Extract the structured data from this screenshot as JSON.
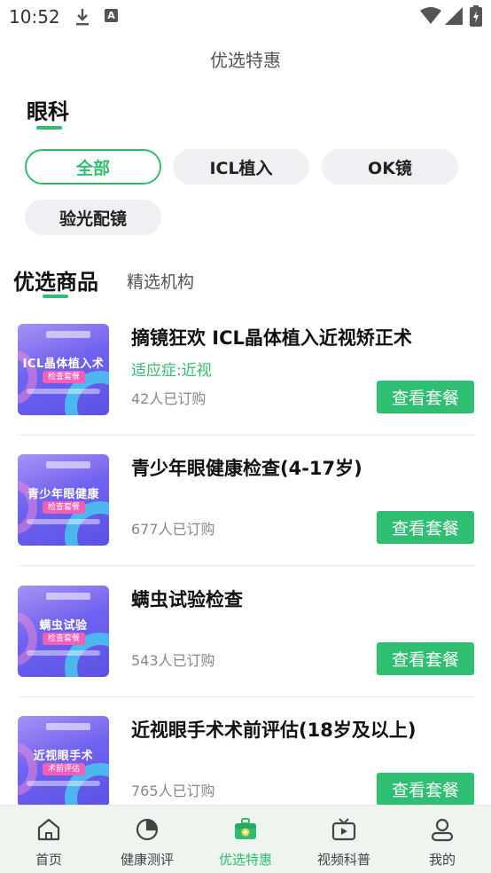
{
  "status_bar": {
    "time": "10:52",
    "a_badge": "A"
  },
  "header": {
    "title": "优选特惠"
  },
  "category": {
    "title": "眼科"
  },
  "chips": [
    {
      "label": "全部",
      "active": true
    },
    {
      "label": "ICL植入",
      "active": false
    },
    {
      "label": "OK镜",
      "active": false
    },
    {
      "label": "验光配镜",
      "active": false
    }
  ],
  "tabs": {
    "main": "优选商品",
    "secondary": "精选机构"
  },
  "products": [
    {
      "name": "摘镜狂欢 ICL晶体植入近视矫正术",
      "tag": "适应症:近视",
      "sold": "42人已订购",
      "button": "查看套餐",
      "thumb_title": "ICL晶体植入术",
      "thumb_badge": "检查套餐"
    },
    {
      "name": "青少年眼健康检查(4-17岁)",
      "tag": "",
      "sold": "677人已订购",
      "button": "查看套餐",
      "thumb_title": "青少年眼健康",
      "thumb_badge": "检查套餐"
    },
    {
      "name": "螨虫试验检查",
      "tag": "",
      "sold": "543人已订购",
      "button": "查看套餐",
      "thumb_title": "螨虫试验",
      "thumb_badge": "检查套餐"
    },
    {
      "name": "近视眼手术术前评估(18岁及以上)",
      "tag": "",
      "sold": "765人已订购",
      "button": "查看套餐",
      "thumb_title": "近视眼手术",
      "thumb_badge": "术前评估"
    }
  ],
  "bottom_nav": [
    {
      "label": "首页",
      "icon": "home-icon",
      "active": false
    },
    {
      "label": "健康测评",
      "icon": "pie-chart-icon",
      "active": false
    },
    {
      "label": "优选特惠",
      "icon": "medical-kit-icon",
      "active": true
    },
    {
      "label": "视频科普",
      "icon": "tv-play-icon",
      "active": false
    },
    {
      "label": "我的",
      "icon": "user-icon",
      "active": false
    }
  ],
  "colors": {
    "accent": "#2fbf71",
    "chip_bg": "#eef0f4",
    "nav_bg": "#eef5ef"
  }
}
